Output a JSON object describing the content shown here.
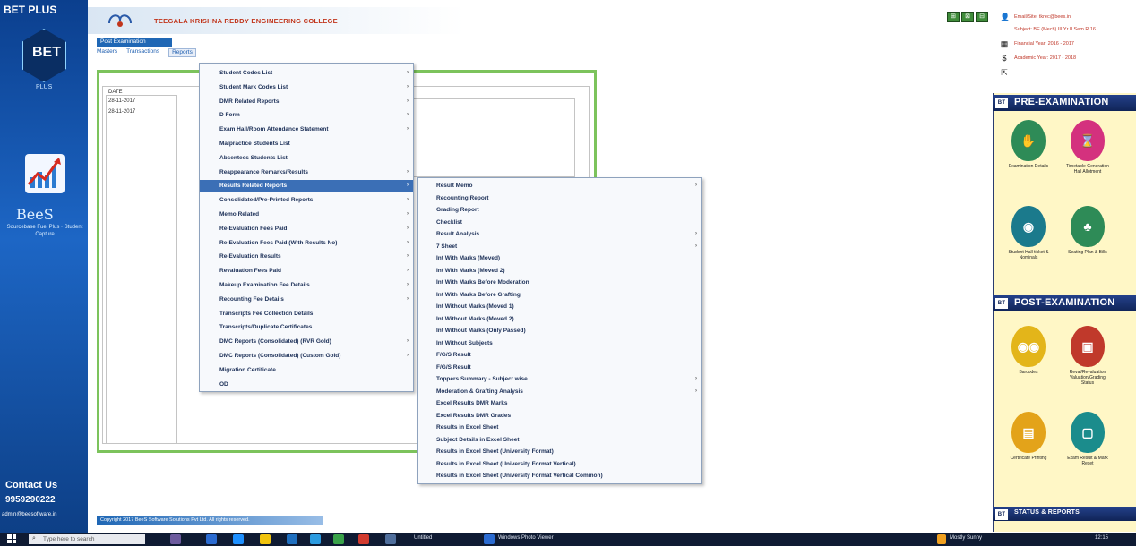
{
  "left_panel": {
    "title": "BET PLUS",
    "logo_text": "BET",
    "logo_sub": "PLUS",
    "bees": "BeeS",
    "bees_sub": "Sourcebase Fuel Plus ·  Student Capture",
    "contact_title": "Contact Us",
    "contact_phone": "9959290222",
    "contact_email": "admin@beesoftware.in"
  },
  "header": {
    "college_name": "TEEGALA KRISHNA REDDY ENGINEERING COLLEGE",
    "exam_bar": "Post Examination",
    "menubar": [
      "Masters",
      "Transactions",
      "Reports"
    ]
  },
  "list": {
    "header": "DATE",
    "rows": [
      "28-11-2017",
      "28-11-2017"
    ]
  },
  "reports_menu": {
    "items": [
      {
        "label": "Student Codes List",
        "arrow": "›"
      },
      {
        "label": "Student Mark Codes List",
        "arrow": "›"
      },
      {
        "label": "DMR Related Reports",
        "arrow": "›"
      },
      {
        "label": "D Form",
        "arrow": "›"
      },
      {
        "label": "Exam Hall/Room Attendance Statement",
        "arrow": "›"
      },
      {
        "label": "Malpractice Students List",
        "arrow": ""
      },
      {
        "label": "Absentees Students List",
        "arrow": ""
      },
      {
        "label": "Reappearance Remarks/Results",
        "arrow": "›"
      },
      {
        "label": "Results Related Reports",
        "arrow": "›"
      },
      {
        "label": "Consolidated/Pre-Printed Reports",
        "arrow": "›"
      },
      {
        "label": "Memo Related",
        "arrow": "›"
      },
      {
        "label": "Re-Evaluation Fees Paid",
        "arrow": "›"
      },
      {
        "label": "Re-Evaluation Fees Paid (With Results No)",
        "arrow": "›"
      },
      {
        "label": "Re-Evaluation Results",
        "arrow": "›"
      },
      {
        "label": "Revaluation Fees Paid",
        "arrow": "›"
      },
      {
        "label": "Makeup Examination Fee Details",
        "arrow": "›"
      },
      {
        "label": "Recounting Fee Details",
        "arrow": "›"
      },
      {
        "label": "Transcripts Fee Collection Details",
        "arrow": ""
      },
      {
        "label": "Transcripts/Duplicate Certificates",
        "arrow": ""
      },
      {
        "label": "DMC Reports (Consolidated) (RVR Gold)",
        "arrow": "›"
      },
      {
        "label": "DMC Reports (Consolidated) (Custom Gold)",
        "arrow": "›"
      },
      {
        "label": "Migration Certificate",
        "arrow": ""
      },
      {
        "label": "OD",
        "arrow": ""
      }
    ]
  },
  "results_menu": {
    "items": [
      {
        "label": "Result Memo",
        "arrow": "›"
      },
      {
        "label": "Recounting Report",
        "arrow": ""
      },
      {
        "label": "Grading Report",
        "arrow": ""
      },
      {
        "label": "Checklist",
        "arrow": ""
      },
      {
        "label": "Result Analysis",
        "arrow": "›"
      },
      {
        "label": "7 Sheet",
        "arrow": "›"
      },
      {
        "label": "Int With Marks (Moved)",
        "arrow": ""
      },
      {
        "label": "Int With Marks (Moved 2)",
        "arrow": ""
      },
      {
        "label": "Int With Marks Before Moderation",
        "arrow": ""
      },
      {
        "label": "Int With Marks Before Grafting",
        "arrow": ""
      },
      {
        "label": "Int Without Marks (Moved 1)",
        "arrow": ""
      },
      {
        "label": "Int Without Marks (Moved 2)",
        "arrow": ""
      },
      {
        "label": "Int Without Marks (Only Passed)",
        "arrow": ""
      },
      {
        "label": "Int Without Subjects",
        "arrow": ""
      },
      {
        "label": "F/G/S Result",
        "arrow": ""
      },
      {
        "label": "F/G/S Result",
        "arrow": ""
      },
      {
        "label": "Toppers Summary - Subject wise",
        "arrow": "›"
      },
      {
        "label": "Moderation & Grafting Analysis",
        "arrow": "›"
      },
      {
        "label": "Excel Results DMR Marks",
        "arrow": ""
      },
      {
        "label": "Excel Results DMR Grades",
        "arrow": ""
      },
      {
        "label": "Results in Excel Sheet",
        "arrow": ""
      },
      {
        "label": "Subject Details in Excel Sheet",
        "arrow": ""
      },
      {
        "label": "Results in Excel Sheet (University Format)",
        "arrow": ""
      },
      {
        "label": "Results in Excel Sheet (University Format Vertical)",
        "arrow": ""
      },
      {
        "label": "Results in Excel Sheet (University Format Vertical Common)",
        "arrow": ""
      }
    ]
  },
  "footer": {
    "text": "Copyright 2017 BeeS Software Solutions Pvt Ltd. All rights reserved."
  },
  "user_info": {
    "lines": [
      "Email/Site: tkrec@bees.in",
      "Subject: BE (Mech) III Yr II Sem R 16",
      "Financial Year: 2016 - 2017",
      "Academic Year: 2017 - 2018"
    ]
  },
  "top_buttons": [
    "⊞",
    "⊠",
    "⊟"
  ],
  "pre_exam": {
    "title": "PRE-EXAMINATION",
    "tiles": [
      {
        "label": "Examination Details",
        "color": "#2e8b57",
        "glyph": "✋"
      },
      {
        "label": "Timetable Generation Hall Allotment",
        "color": "#d4317e",
        "glyph": "⌛"
      },
      {
        "label": "Student Hall ticket & Nominals",
        "color": "#1b7a8c",
        "glyph": "◉"
      },
      {
        "label": "Seating Plan & Bills",
        "color": "#2e8b57",
        "glyph": "♣"
      }
    ]
  },
  "post_exam": {
    "title": "POST-EXAMINATION",
    "tiles": [
      {
        "label": "Barcodes",
        "color": "#e3b51a",
        "glyph": "◉◉"
      },
      {
        "label": "Reval/Revaluation Valuation/Grading Status",
        "color": "#c0392b",
        "glyph": "▣"
      },
      {
        "label": "Certificate Printing",
        "color": "#e3a31a",
        "glyph": "▤"
      },
      {
        "label": "Exam Result & Mark Reset",
        "color": "#1b8c8c",
        "glyph": "▢"
      }
    ]
  },
  "third_section": {
    "title": "STATUS & REPORTS"
  },
  "taskbar": {
    "search_placeholder": "Type here to search",
    "app_labels": [
      "Untitled",
      "Windows Photo Viewer"
    ],
    "tray_text": "Mostly Sunny",
    "clock": "12:15"
  }
}
